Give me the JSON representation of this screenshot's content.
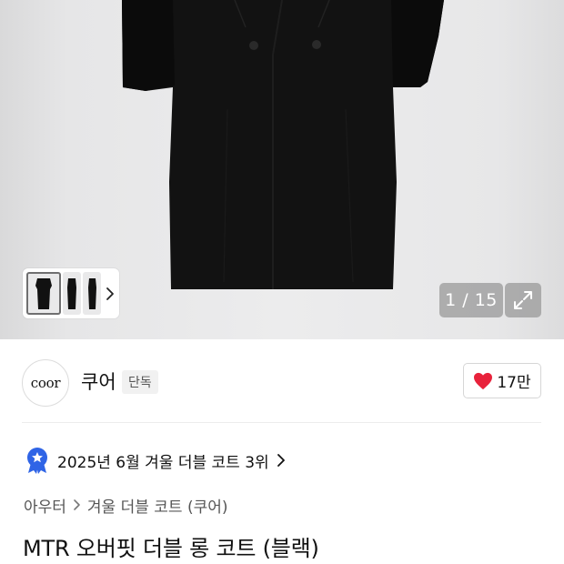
{
  "gallery": {
    "counter": "1 / 15",
    "thumbnails": [
      "front-view",
      "side-view",
      "back-view"
    ]
  },
  "brand": {
    "logo_text": "coor",
    "name": "쿠어",
    "badge": "단독",
    "likes": "17만"
  },
  "ranking": {
    "text": "2025년 6월 겨울 더블 코트 3위"
  },
  "breadcrumb": {
    "items": [
      "아우터",
      "겨울 더블 코트 (쿠어)"
    ]
  },
  "product": {
    "title": "MTR 오버핏 더블 롱 코트 (블랙)"
  },
  "colors": {
    "heart": "#e8223b",
    "rank_badge": "#2f64e6",
    "coat": "#111111"
  },
  "icons": {
    "expand": "expand-icon",
    "next": "chevron-right-icon",
    "like": "heart-icon",
    "rank": "ranking-badge-icon"
  }
}
